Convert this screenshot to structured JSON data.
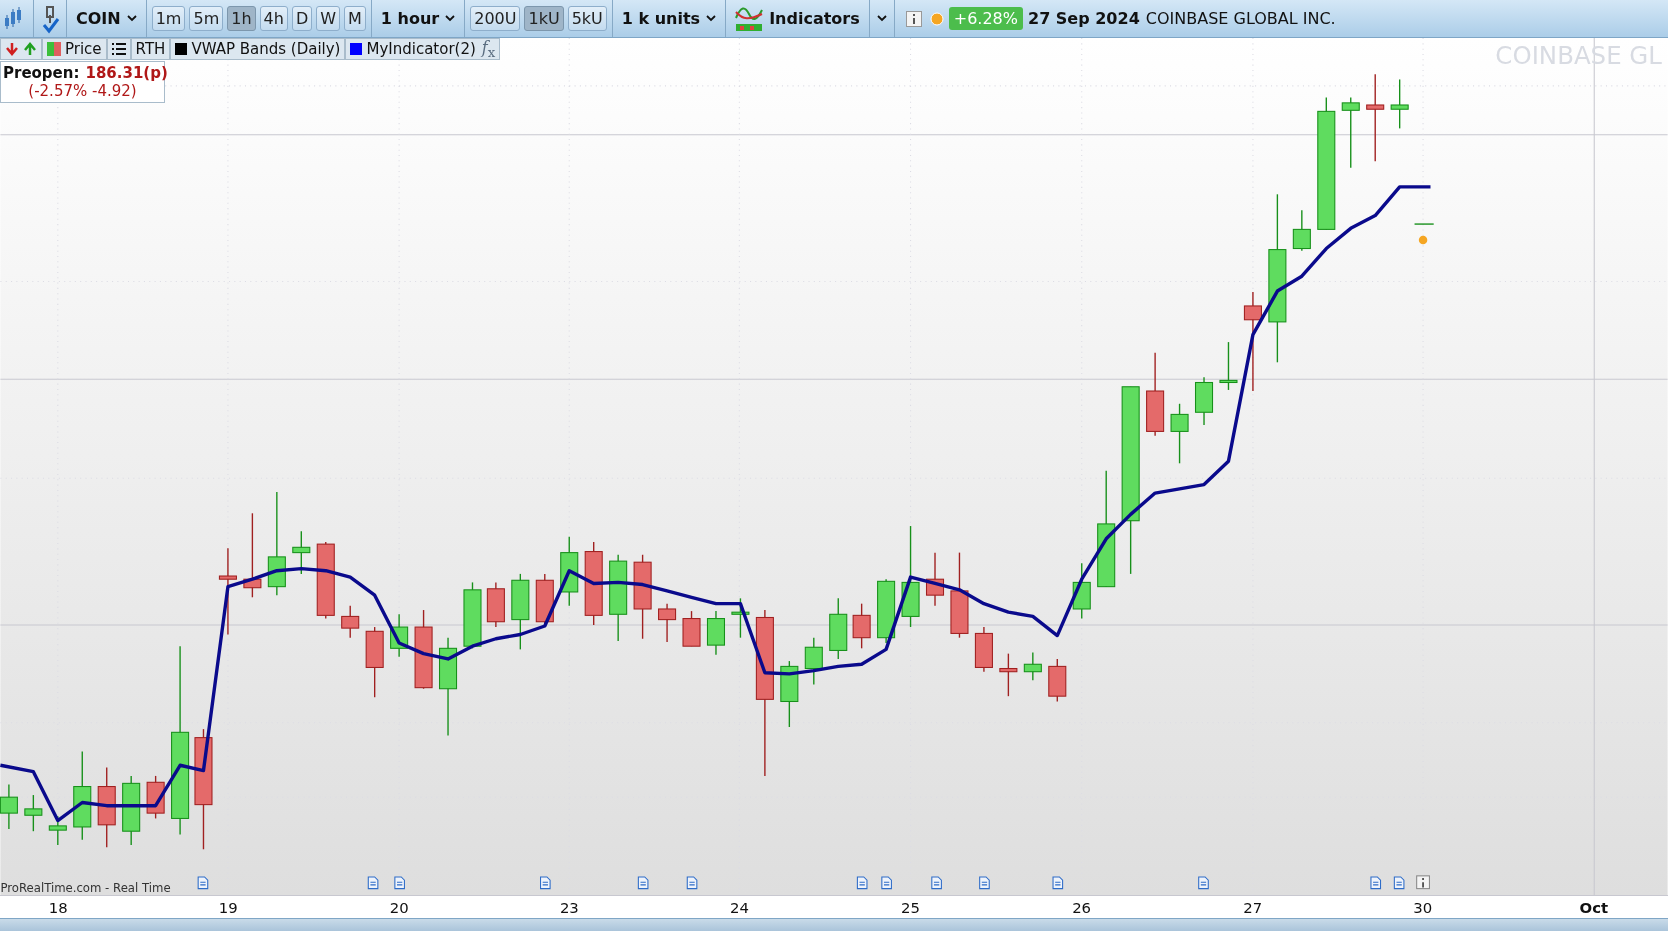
{
  "toolbar": {
    "symbol": "COIN",
    "timeframes": [
      {
        "label": "1m",
        "selected": false
      },
      {
        "label": "5m",
        "selected": false
      },
      {
        "label": "1h",
        "selected": true
      },
      {
        "label": "4h",
        "selected": false
      },
      {
        "label": "D",
        "selected": false
      },
      {
        "label": "W",
        "selected": false
      },
      {
        "label": "M",
        "selected": false
      }
    ],
    "interval": "1 hour",
    "unit_presets": [
      {
        "label": "200U",
        "selected": false
      },
      {
        "label": "1kU",
        "selected": true
      },
      {
        "label": "5kU",
        "selected": false
      }
    ],
    "units": "1 k units",
    "indicators": "Indicators",
    "change": "+6.28%",
    "date": "27 Sep 2024",
    "name": "COINBASE GLOBAL INC."
  },
  "legend": {
    "items": [
      {
        "kind": "price",
        "label": "Price"
      },
      {
        "kind": "plain",
        "label": "RTH"
      },
      {
        "kind": "swatch",
        "label": "VWAP Bands (Daily)",
        "color": "#000000"
      },
      {
        "kind": "swatch",
        "label": "MyIndicator(2)",
        "color": "#0000ff"
      }
    ],
    "formula": "*f*$_{x}$"
  },
  "preopen": {
    "label": "Preopen:",
    "price": "186.31(p)",
    "change": "(-2.57% -4.92)"
  },
  "chart": {
    "watermark": "COINBASE GL",
    "source": "ProRealTime.com - Real Time"
  },
  "x_axis": [
    {
      "label": "18",
      "kind": "day"
    },
    {
      "label": "19",
      "kind": "day"
    },
    {
      "label": "20",
      "kind": "day"
    },
    {
      "label": "23",
      "kind": "day"
    },
    {
      "label": "24",
      "kind": "day"
    },
    {
      "label": "25",
      "kind": "day"
    },
    {
      "label": "26",
      "kind": "day"
    },
    {
      "label": "27",
      "kind": "day"
    },
    {
      "label": "30",
      "kind": "day"
    },
    {
      "label": "Oct",
      "kind": "month"
    }
  ]
}
